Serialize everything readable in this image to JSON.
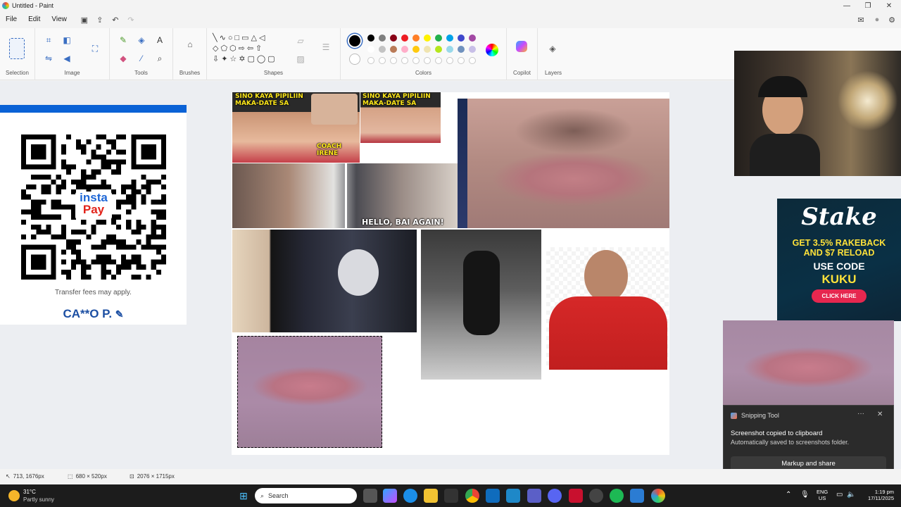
{
  "window": {
    "title": "Untitled - Paint"
  },
  "menu": {
    "file": "File",
    "edit": "Edit",
    "view": "View"
  },
  "ribbon": {
    "selection": "Selection",
    "image": "Image",
    "tools": "Tools",
    "brushes": "Brushes",
    "shapes": "Shapes",
    "colors": "Colors",
    "copilot": "Copilot",
    "layers": "Layers",
    "palette_row1": [
      "#000000",
      "#7f7f7f",
      "#880015",
      "#ed1c24",
      "#ff7f27",
      "#fff200",
      "#22b14c",
      "#00a2e8",
      "#3f48cc",
      "#a349a4"
    ],
    "palette_row2": [
      "#ffffff",
      "#c3c3c3",
      "#b97a57",
      "#ffaec9",
      "#ffc90e",
      "#efe4b0",
      "#b5e61d",
      "#99d9ea",
      "#7092be",
      "#c8bfe7"
    ]
  },
  "canvas": {
    "thumb1_text": "SINO KAYA PIPILIIN MAKA-DATE SA",
    "thumb1_sub": "COACH IRENE",
    "thumb2_text": "SINO KAYA PIPILIIN MAKA-DATE SA",
    "thumb3_text": "HELLO, BAI AGAIN!"
  },
  "qr_panel": {
    "brand1": "insta",
    "brand2": "Pay",
    "fees": "Transfer fees may apply.",
    "name": "CA**O P."
  },
  "stake_ad": {
    "logo": "Stake",
    "line1": "GET 3.5% RAKEBACK",
    "line2": "AND $7 RELOAD",
    "line3": "USE CODE",
    "code": "KUKU",
    "cta": "CLICK HERE"
  },
  "toast": {
    "app": "Snipping Tool",
    "title": "Screenshot copied to clipboard",
    "body": "Automatically saved to screenshots folder.",
    "action": "Markup and share"
  },
  "status": {
    "cursor": "713, 1676px",
    "selection": "680 × 520px",
    "canvas": "2076 × 1715px"
  },
  "taskbar": {
    "weather_temp": "31°C",
    "weather_desc": "Partly sunny",
    "search": "Search",
    "lang1": "ENG",
    "lang2": "US",
    "time": "1:19 pm",
    "date": "17/11/2025"
  }
}
